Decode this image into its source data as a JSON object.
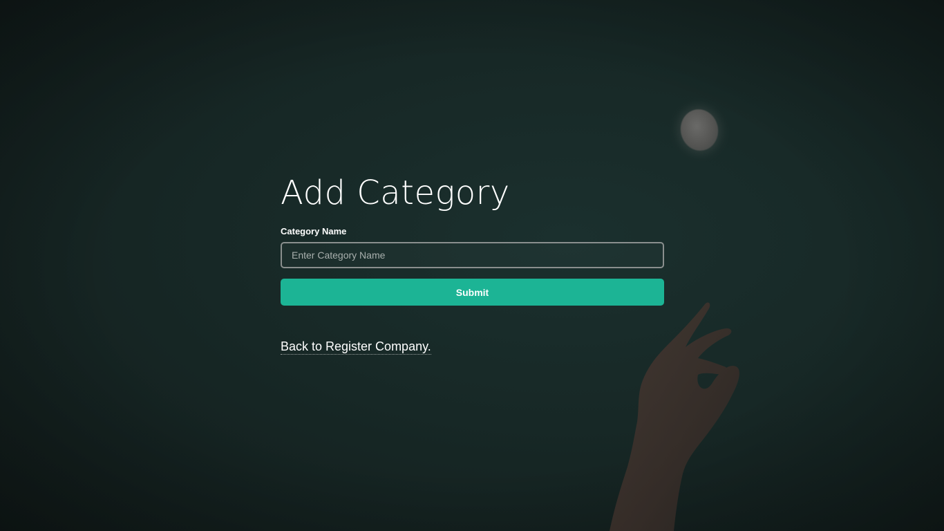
{
  "page": {
    "title": "Add Category"
  },
  "form": {
    "category_label": "Category Name",
    "category_value": "",
    "category_placeholder": "Enter Category Name",
    "submit_label": "Submit"
  },
  "nav": {
    "back_link": "Back to Register Company."
  },
  "colors": {
    "accent": "#1cb495",
    "background": "#172826",
    "text": "#ffffff"
  }
}
